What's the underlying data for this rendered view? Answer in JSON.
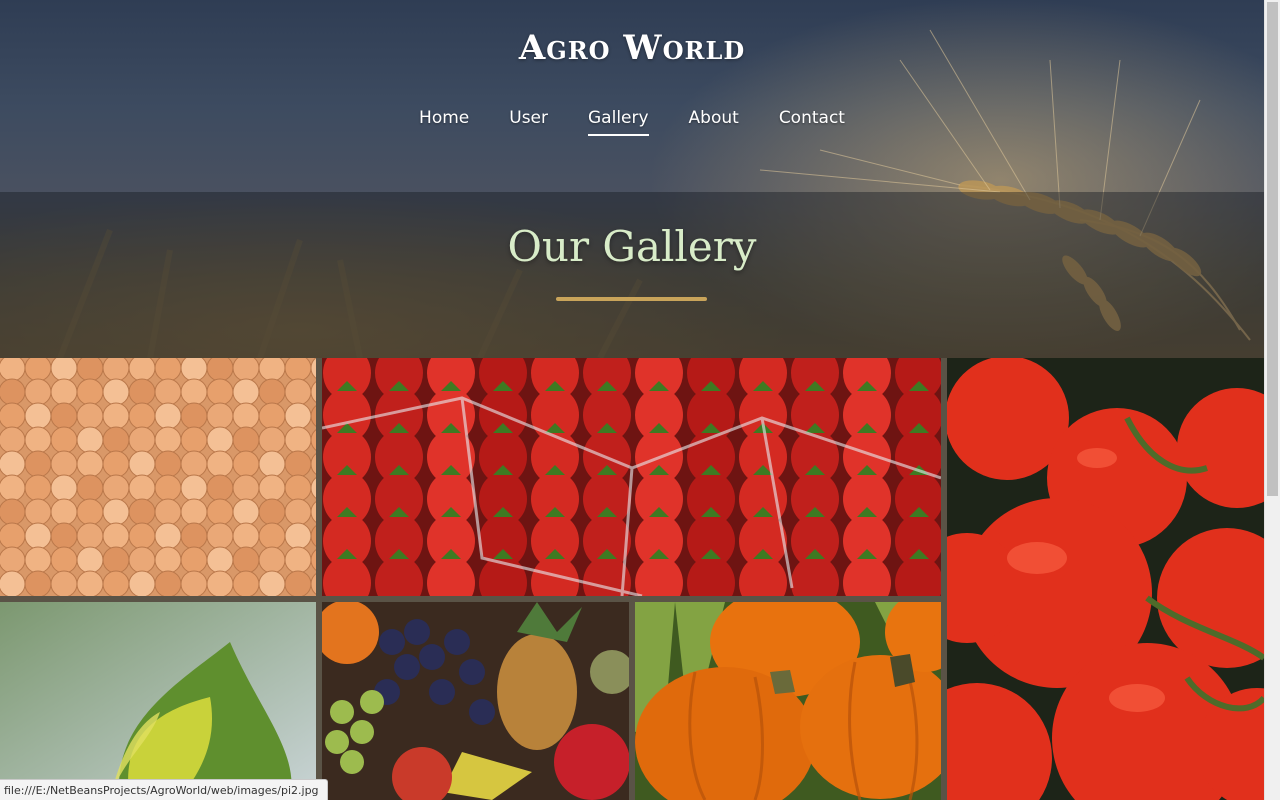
{
  "brand": {
    "title": "Agro World"
  },
  "nav": {
    "items": [
      {
        "label": "Home",
        "active": false
      },
      {
        "label": "User",
        "active": false
      },
      {
        "label": "Gallery",
        "active": true
      },
      {
        "label": "About",
        "active": false
      },
      {
        "label": "Contact",
        "active": false
      }
    ]
  },
  "gallery": {
    "title": "Our Gallery",
    "accent_color": "#c9a45a",
    "tiles": [
      {
        "subject": "apricots"
      },
      {
        "subject": "strawberries"
      },
      {
        "subject": "tomatoes"
      },
      {
        "subject": "leaf"
      },
      {
        "subject": "mixed fruits"
      },
      {
        "subject": "pumpkins"
      }
    ]
  },
  "status_bar": {
    "url": "file:///E:/NetBeansProjects/AgroWorld/web/images/pi2.jpg"
  },
  "colors": {
    "title_color": "#d8ecc8",
    "nav_text": "#ffffff"
  }
}
